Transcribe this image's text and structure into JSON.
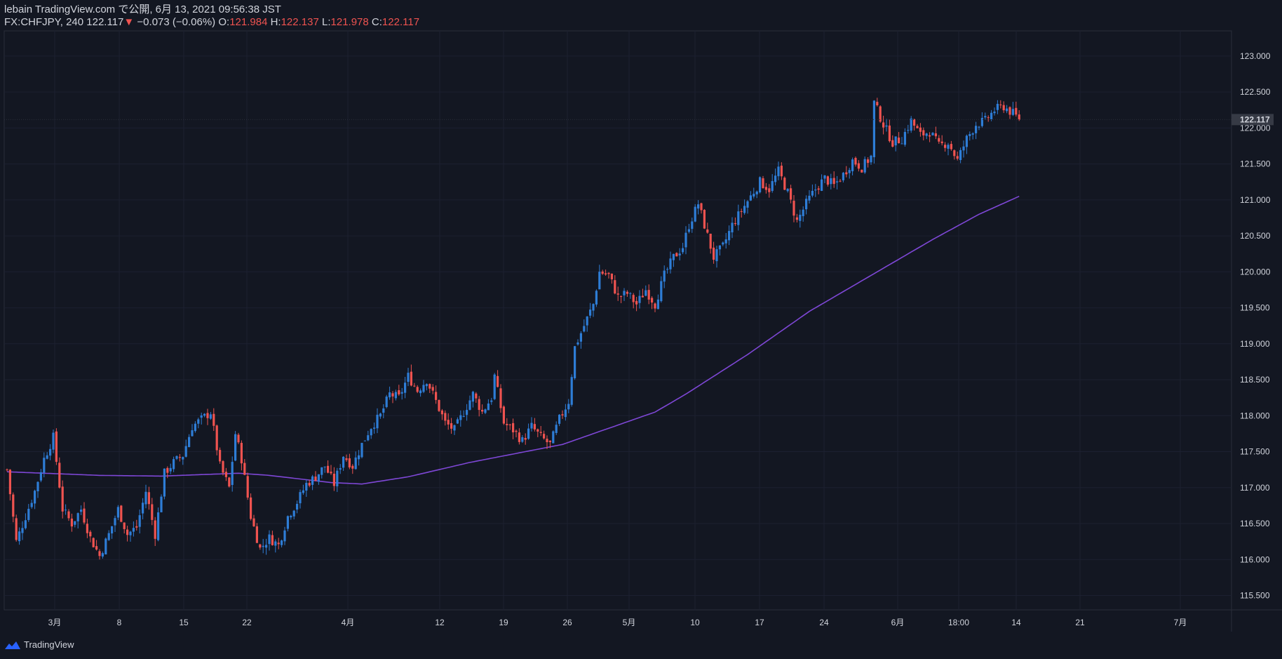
{
  "header": {
    "published_line": "lebain TradingView.com で公開, 6月 13, 2021 09:56:38 JST",
    "symbol": "FX:CHFJPY, 240",
    "last": "122.117",
    "change_arrow": "▼",
    "change": "−0.073 (−0.06%)",
    "o_label": "O:",
    "o_value": "121.984",
    "h_label": "H:",
    "h_value": "122.137",
    "l_label": "L:",
    "l_value": "121.978",
    "c_label": "C:",
    "c_value": "122.117"
  },
  "footer": {
    "brand": "TradingView",
    "logo_icon": "tradingview-logo-icon"
  },
  "colors": {
    "background": "#131722",
    "up": "#2e7dd6",
    "down": "#ef5350",
    "ma": "#7e47d6",
    "grid": "#1c2030",
    "text": "#d1d4dc",
    "last_price_label": "#363a45"
  },
  "chart_data": {
    "type": "candlestick",
    "symbol": "FX:CHFJPY",
    "interval": "240",
    "ylim": [
      115.3,
      123.35
    ],
    "y_ticks": [
      "115.500",
      "116.000",
      "116.500",
      "117.000",
      "117.500",
      "118.000",
      "118.500",
      "119.000",
      "119.500",
      "120.000",
      "120.500",
      "121.000",
      "121.500",
      "122.000",
      "122.500",
      "123.000"
    ],
    "x_tick_labels": [
      "3月",
      "8",
      "15",
      "22",
      "4月",
      "12",
      "19",
      "26",
      "5月",
      "10",
      "17",
      "24",
      "6月",
      "18:00",
      "14",
      "21",
      "7月"
    ],
    "last_price": "122.117",
    "close_path": [
      [
        0,
        117.25
      ],
      [
        3,
        116.25
      ],
      [
        6,
        116.6
      ],
      [
        9,
        116.95
      ],
      [
        12,
        117.4
      ],
      [
        15,
        117.7
      ],
      [
        18,
        116.7
      ],
      [
        21,
        116.5
      ],
      [
        24,
        116.7
      ],
      [
        27,
        116.3
      ],
      [
        30,
        116.05
      ],
      [
        33,
        116.35
      ],
      [
        36,
        116.7
      ],
      [
        39,
        116.35
      ],
      [
        42,
        116.45
      ],
      [
        45,
        116.95
      ],
      [
        48,
        116.35
      ],
      [
        51,
        117.2
      ],
      [
        54,
        117.35
      ],
      [
        57,
        117.45
      ],
      [
        60,
        117.85
      ],
      [
        63,
        117.95
      ],
      [
        66,
        118.05
      ],
      [
        69,
        117.3
      ],
      [
        72,
        117.0
      ],
      [
        74,
        117.75
      ],
      [
        76,
        117.4
      ],
      [
        79,
        116.6
      ],
      [
        82,
        116.15
      ],
      [
        85,
        116.3
      ],
      [
        88,
        116.2
      ],
      [
        91,
        116.6
      ],
      [
        94,
        116.8
      ],
      [
        97,
        117.05
      ],
      [
        100,
        117.15
      ],
      [
        103,
        117.3
      ],
      [
        106,
        117.05
      ],
      [
        109,
        117.45
      ],
      [
        112,
        117.3
      ],
      [
        115,
        117.6
      ],
      [
        118,
        117.85
      ],
      [
        121,
        118.0
      ],
      [
        124,
        118.3
      ],
      [
        127,
        118.25
      ],
      [
        130,
        118.55
      ],
      [
        133,
        118.35
      ],
      [
        136,
        118.5
      ],
      [
        139,
        118.2
      ],
      [
        142,
        117.9
      ],
      [
        145,
        117.8
      ],
      [
        148,
        118.05
      ],
      [
        151,
        118.3
      ],
      [
        154,
        118.05
      ],
      [
        157,
        118.25
      ],
      [
        158,
        118.55
      ],
      [
        161,
        117.9
      ],
      [
        164,
        117.8
      ],
      [
        167,
        117.65
      ],
      [
        170,
        117.85
      ],
      [
        173,
        117.7
      ],
      [
        176,
        117.6
      ],
      [
        179,
        117.95
      ],
      [
        182,
        118.2
      ],
      [
        184,
        118.95
      ],
      [
        187,
        119.25
      ],
      [
        190,
        119.55
      ],
      [
        192,
        120.0
      ],
      [
        195,
        119.95
      ],
      [
        198,
        119.65
      ],
      [
        201,
        119.7
      ],
      [
        204,
        119.55
      ],
      [
        207,
        119.75
      ],
      [
        210,
        119.55
      ],
      [
        213,
        119.95
      ],
      [
        216,
        120.2
      ],
      [
        219,
        120.35
      ],
      [
        221,
        120.65
      ],
      [
        224,
        120.95
      ],
      [
        227,
        120.5
      ],
      [
        229,
        120.2
      ],
      [
        232,
        120.35
      ],
      [
        235,
        120.65
      ],
      [
        238,
        120.85
      ],
      [
        241,
        121.05
      ],
      [
        244,
        121.25
      ],
      [
        247,
        121.15
      ],
      [
        250,
        121.4
      ],
      [
        253,
        121.1
      ],
      [
        256,
        120.7
      ],
      [
        259,
        120.95
      ],
      [
        262,
        121.15
      ],
      [
        265,
        121.3
      ],
      [
        268,
        121.2
      ],
      [
        271,
        121.35
      ],
      [
        274,
        121.55
      ],
      [
        277,
        121.45
      ],
      [
        280,
        121.6
      ],
      [
        281,
        122.35
      ],
      [
        284,
        122.05
      ],
      [
        287,
        121.8
      ],
      [
        290,
        121.85
      ],
      [
        293,
        122.1
      ],
      [
        296,
        121.9
      ],
      [
        299,
        121.95
      ],
      [
        302,
        121.75
      ],
      [
        305,
        121.8
      ],
      [
        308,
        121.55
      ],
      [
        311,
        121.85
      ],
      [
        314,
        122.05
      ],
      [
        317,
        122.1
      ],
      [
        320,
        122.25
      ],
      [
        323,
        122.3
      ],
      [
        326,
        122.2
      ],
      [
        328,
        122.117
      ]
    ],
    "ma_path": [
      [
        0,
        117.22
      ],
      [
        30,
        117.17
      ],
      [
        50,
        117.16
      ],
      [
        75,
        117.2
      ],
      [
        85,
        117.17
      ],
      [
        105,
        117.07
      ],
      [
        115,
        117.05
      ],
      [
        130,
        117.15
      ],
      [
        150,
        117.35
      ],
      [
        180,
        117.6
      ],
      [
        210,
        118.05
      ],
      [
        220,
        118.3
      ],
      [
        240,
        118.85
      ],
      [
        260,
        119.45
      ],
      [
        280,
        119.95
      ],
      [
        300,
        120.45
      ],
      [
        315,
        120.8
      ],
      [
        328,
        121.05
      ]
    ]
  }
}
